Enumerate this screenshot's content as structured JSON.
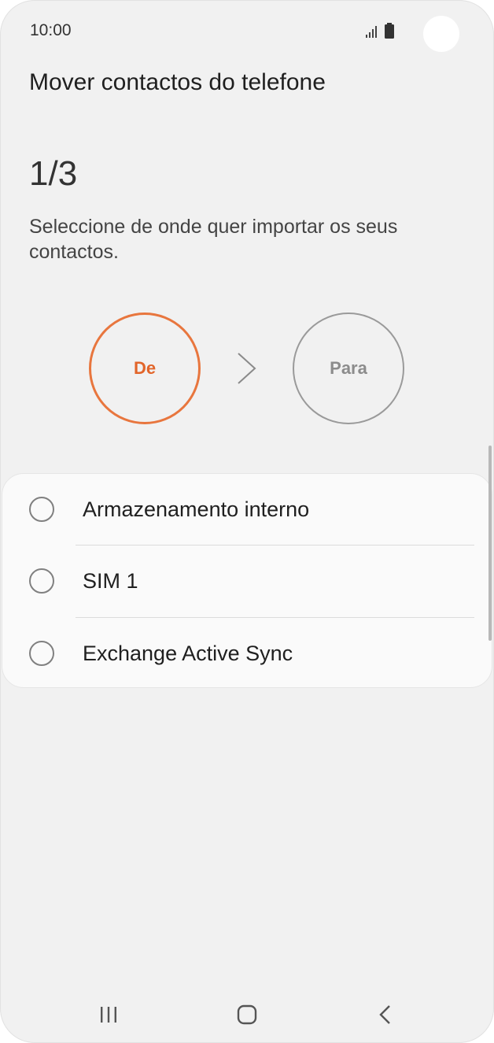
{
  "status_bar": {
    "time": "10:00",
    "icons": [
      "signal-icon",
      "battery-icon"
    ]
  },
  "header": {
    "title": "Mover contactos do telefone"
  },
  "step": {
    "counter": "1/3",
    "instructions": "Seleccione de onde quer importar os seus contactos.",
    "from_label": "De",
    "to_label": "Para",
    "active_color": "#e8763e",
    "inactive_color": "#9a9a9a"
  },
  "options": [
    {
      "label": "Armazenamento interno",
      "selected": false
    },
    {
      "label": "SIM 1",
      "selected": false
    },
    {
      "label": "Exchange Active Sync",
      "selected": false
    }
  ],
  "nav_bar": {
    "buttons": [
      "recent-apps-icon",
      "home-icon",
      "back-icon"
    ]
  }
}
